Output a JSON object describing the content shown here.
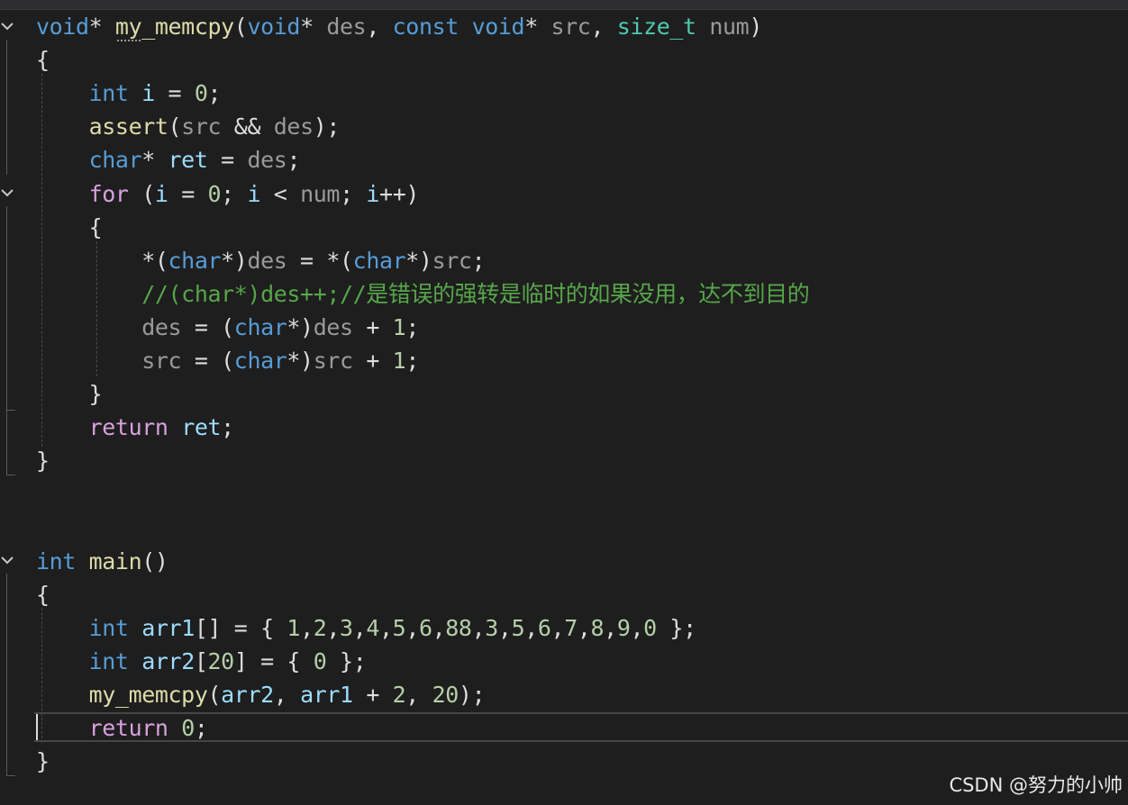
{
  "editor": {
    "lines": [
      [
        {
          "t": "void",
          "c": "kw"
        },
        {
          "t": "* ",
          "c": "plain"
        },
        {
          "t": "my_memcpy",
          "c": "fn"
        },
        {
          "t": "(",
          "c": "plain"
        },
        {
          "t": "void",
          "c": "kw"
        },
        {
          "t": "* ",
          "c": "plain"
        },
        {
          "t": "des",
          "c": "par"
        },
        {
          "t": ", ",
          "c": "plain"
        },
        {
          "t": "const",
          "c": "kw"
        },
        {
          "t": " ",
          "c": "plain"
        },
        {
          "t": "void",
          "c": "kw"
        },
        {
          "t": "* ",
          "c": "plain"
        },
        {
          "t": "src",
          "c": "par"
        },
        {
          "t": ", ",
          "c": "plain"
        },
        {
          "t": "size_t",
          "c": "type"
        },
        {
          "t": " ",
          "c": "plain"
        },
        {
          "t": "num",
          "c": "par"
        },
        {
          "t": ")",
          "c": "plain"
        }
      ],
      [
        {
          "t": "{",
          "c": "plain"
        }
      ],
      [
        {
          "t": "    ",
          "c": "plain"
        },
        {
          "t": "int",
          "c": "kw"
        },
        {
          "t": " ",
          "c": "plain"
        },
        {
          "t": "i",
          "c": "var"
        },
        {
          "t": " = ",
          "c": "plain"
        },
        {
          "t": "0",
          "c": "num"
        },
        {
          "t": ";",
          "c": "plain"
        }
      ],
      [
        {
          "t": "    ",
          "c": "plain"
        },
        {
          "t": "assert",
          "c": "fn"
        },
        {
          "t": "(",
          "c": "plain"
        },
        {
          "t": "src",
          "c": "par"
        },
        {
          "t": " && ",
          "c": "plain"
        },
        {
          "t": "des",
          "c": "par"
        },
        {
          "t": ");",
          "c": "plain"
        }
      ],
      [
        {
          "t": "    ",
          "c": "plain"
        },
        {
          "t": "char",
          "c": "kw"
        },
        {
          "t": "* ",
          "c": "plain"
        },
        {
          "t": "ret",
          "c": "var"
        },
        {
          "t": " = ",
          "c": "plain"
        },
        {
          "t": "des",
          "c": "par"
        },
        {
          "t": ";",
          "c": "plain"
        }
      ],
      [
        {
          "t": "    ",
          "c": "plain"
        },
        {
          "t": "for",
          "c": "ctrl"
        },
        {
          "t": " (",
          "c": "plain"
        },
        {
          "t": "i",
          "c": "var"
        },
        {
          "t": " = ",
          "c": "plain"
        },
        {
          "t": "0",
          "c": "num"
        },
        {
          "t": "; ",
          "c": "plain"
        },
        {
          "t": "i",
          "c": "var"
        },
        {
          "t": " < ",
          "c": "plain"
        },
        {
          "t": "num",
          "c": "par"
        },
        {
          "t": "; ",
          "c": "plain"
        },
        {
          "t": "i",
          "c": "var"
        },
        {
          "t": "++)",
          "c": "plain"
        }
      ],
      [
        {
          "t": "    {",
          "c": "plain"
        }
      ],
      [
        {
          "t": "        *(",
          "c": "plain"
        },
        {
          "t": "char",
          "c": "kw"
        },
        {
          "t": "*)",
          "c": "plain"
        },
        {
          "t": "des",
          "c": "par"
        },
        {
          "t": " = *(",
          "c": "plain"
        },
        {
          "t": "char",
          "c": "kw"
        },
        {
          "t": "*)",
          "c": "plain"
        },
        {
          "t": "src",
          "c": "par"
        },
        {
          "t": ";",
          "c": "plain"
        }
      ],
      [
        {
          "t": "        ",
          "c": "plain"
        },
        {
          "t": "//(char*)des++;//是错误的强转是临时的如果没用，达不到目的",
          "c": "com"
        }
      ],
      [
        {
          "t": "        ",
          "c": "plain"
        },
        {
          "t": "des",
          "c": "par"
        },
        {
          "t": " = (",
          "c": "plain"
        },
        {
          "t": "char",
          "c": "kw"
        },
        {
          "t": "*)",
          "c": "plain"
        },
        {
          "t": "des",
          "c": "par"
        },
        {
          "t": " + ",
          "c": "plain"
        },
        {
          "t": "1",
          "c": "num"
        },
        {
          "t": ";",
          "c": "plain"
        }
      ],
      [
        {
          "t": "        ",
          "c": "plain"
        },
        {
          "t": "src",
          "c": "par"
        },
        {
          "t": " = (",
          "c": "plain"
        },
        {
          "t": "char",
          "c": "kw"
        },
        {
          "t": "*)",
          "c": "plain"
        },
        {
          "t": "src",
          "c": "par"
        },
        {
          "t": " + ",
          "c": "plain"
        },
        {
          "t": "1",
          "c": "num"
        },
        {
          "t": ";",
          "c": "plain"
        }
      ],
      [
        {
          "t": "    }",
          "c": "plain"
        }
      ],
      [
        {
          "t": "    ",
          "c": "plain"
        },
        {
          "t": "return",
          "c": "ctrl"
        },
        {
          "t": " ",
          "c": "plain"
        },
        {
          "t": "ret",
          "c": "var"
        },
        {
          "t": ";",
          "c": "plain"
        }
      ],
      [
        {
          "t": "}",
          "c": "plain"
        }
      ],
      [],
      [],
      [
        {
          "t": "int",
          "c": "kw"
        },
        {
          "t": " ",
          "c": "plain"
        },
        {
          "t": "main",
          "c": "fn"
        },
        {
          "t": "()",
          "c": "plain"
        }
      ],
      [
        {
          "t": "{",
          "c": "plain"
        }
      ],
      [
        {
          "t": "    ",
          "c": "plain"
        },
        {
          "t": "int",
          "c": "kw"
        },
        {
          "t": " ",
          "c": "plain"
        },
        {
          "t": "arr1",
          "c": "var"
        },
        {
          "t": "[] = { ",
          "c": "plain"
        },
        {
          "t": "1",
          "c": "num"
        },
        {
          "t": ",",
          "c": "plain"
        },
        {
          "t": "2",
          "c": "num"
        },
        {
          "t": ",",
          "c": "plain"
        },
        {
          "t": "3",
          "c": "num"
        },
        {
          "t": ",",
          "c": "plain"
        },
        {
          "t": "4",
          "c": "num"
        },
        {
          "t": ",",
          "c": "plain"
        },
        {
          "t": "5",
          "c": "num"
        },
        {
          "t": ",",
          "c": "plain"
        },
        {
          "t": "6",
          "c": "num"
        },
        {
          "t": ",",
          "c": "plain"
        },
        {
          "t": "88",
          "c": "num"
        },
        {
          "t": ",",
          "c": "plain"
        },
        {
          "t": "3",
          "c": "num"
        },
        {
          "t": ",",
          "c": "plain"
        },
        {
          "t": "5",
          "c": "num"
        },
        {
          "t": ",",
          "c": "plain"
        },
        {
          "t": "6",
          "c": "num"
        },
        {
          "t": ",",
          "c": "plain"
        },
        {
          "t": "7",
          "c": "num"
        },
        {
          "t": ",",
          "c": "plain"
        },
        {
          "t": "8",
          "c": "num"
        },
        {
          "t": ",",
          "c": "plain"
        },
        {
          "t": "9",
          "c": "num"
        },
        {
          "t": ",",
          "c": "plain"
        },
        {
          "t": "0",
          "c": "num"
        },
        {
          "t": " };",
          "c": "plain"
        }
      ],
      [
        {
          "t": "    ",
          "c": "plain"
        },
        {
          "t": "int",
          "c": "kw"
        },
        {
          "t": " ",
          "c": "plain"
        },
        {
          "t": "arr2",
          "c": "var"
        },
        {
          "t": "[",
          "c": "plain"
        },
        {
          "t": "20",
          "c": "num"
        },
        {
          "t": "] = { ",
          "c": "plain"
        },
        {
          "t": "0",
          "c": "num"
        },
        {
          "t": " };",
          "c": "plain"
        }
      ],
      [
        {
          "t": "    ",
          "c": "plain"
        },
        {
          "t": "my_memcpy",
          "c": "fn"
        },
        {
          "t": "(",
          "c": "plain"
        },
        {
          "t": "arr2",
          "c": "var"
        },
        {
          "t": ", ",
          "c": "plain"
        },
        {
          "t": "arr1",
          "c": "var"
        },
        {
          "t": " + ",
          "c": "plain"
        },
        {
          "t": "2",
          "c": "num"
        },
        {
          "t": ", ",
          "c": "plain"
        },
        {
          "t": "20",
          "c": "num"
        },
        {
          "t": ");",
          "c": "plain"
        }
      ],
      [
        {
          "t": "    ",
          "c": "plain"
        },
        {
          "t": "return",
          "c": "ctrl"
        },
        {
          "t": " ",
          "c": "plain"
        },
        {
          "t": "0",
          "c": "num"
        },
        {
          "t": ";",
          "c": "plain"
        }
      ],
      [
        {
          "t": "}",
          "c": "plain"
        }
      ]
    ]
  },
  "colors": {
    "background": "#1e1e1e",
    "keyword": "#569cd6",
    "type": "#4ec9b0",
    "control": "#d8a0df",
    "function": "#dcdcaa",
    "local_var": "#9cdcfe",
    "parameter": "#9a9a9a",
    "number": "#b5cea8",
    "comment": "#57a64a",
    "text": "#dcdcdc"
  },
  "watermark": "CSDN @努力的小帅"
}
